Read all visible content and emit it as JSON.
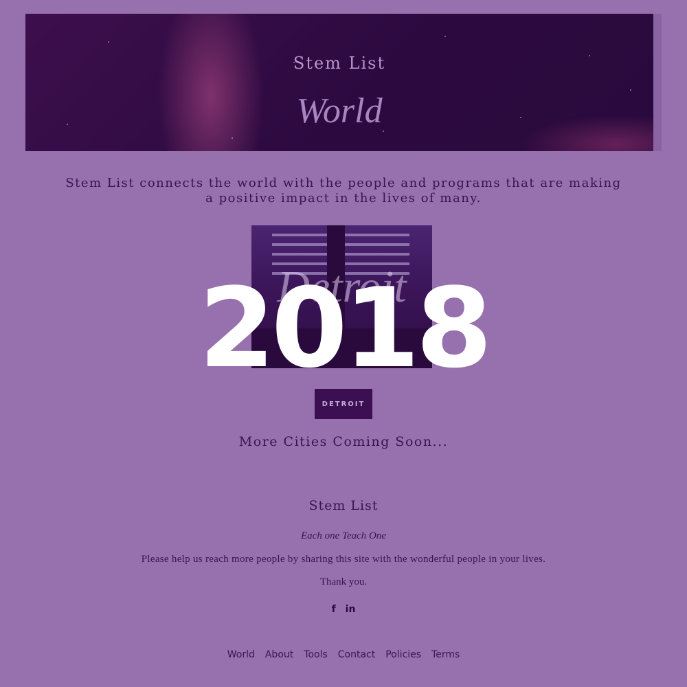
{
  "hero": {
    "title": "Stem List",
    "subtitle": "World"
  },
  "intro": "Stem List connects the world with the people and programs that are making a positive impact in the lives of many.",
  "city_card": {
    "script_label": "Detroit",
    "overlay_year": "2018",
    "button_label": "DETROIT"
  },
  "coming_soon": "More Cities Coming Soon...",
  "footer": {
    "brand": "Stem List",
    "motto": "Each one Teach One",
    "share_text": "Please help us reach more people by sharing this site with the wonderful people in your lives.",
    "thanks": "Thank you.",
    "social": [
      {
        "icon": "facebook-icon",
        "glyph": "f"
      },
      {
        "icon": "linkedin-icon",
        "glyph": "in"
      }
    ]
  },
  "nav": [
    "World",
    "About",
    "Tools",
    "Contact",
    "Policies",
    "Terms"
  ],
  "colors": {
    "background": "#9771ad",
    "dark_purple": "#3b0f52",
    "text": "#3a1350"
  }
}
